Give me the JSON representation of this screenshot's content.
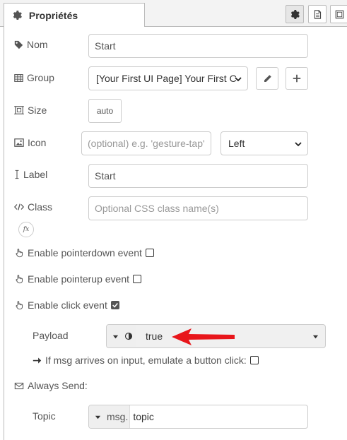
{
  "tab": {
    "title": "Propriétés"
  },
  "icons": {
    "properties": "gear-icon",
    "description": "document-icon",
    "appearance": "window-frame-icon"
  },
  "form": {
    "name": {
      "label": "Nom",
      "value": "Start"
    },
    "group": {
      "label": "Group",
      "value": "[Your First UI Page] Your First C"
    },
    "size": {
      "label": "Size",
      "value": "auto"
    },
    "icon": {
      "label": "Icon",
      "placeholder": "(optional) e.g. 'gesture-tap'",
      "position": "Left"
    },
    "label_field": {
      "label": "Label",
      "value": "Start"
    },
    "class": {
      "label": "Class",
      "placeholder": "Optional CSS class name(s)",
      "fx": "fx"
    },
    "pointerdown": {
      "label": "Enable pointerdown event",
      "checked": false
    },
    "pointerup": {
      "label": "Enable pointerup event",
      "checked": false
    },
    "click": {
      "label": "Enable click event",
      "checked": true
    },
    "payload": {
      "label": "Payload",
      "value": "true"
    },
    "emulate": {
      "label": "If msg arrives on input, emulate a button click:",
      "checked": false
    },
    "always_send": {
      "label": "Always Send:"
    },
    "topic": {
      "label": "Topic",
      "prefix": "msg.",
      "value": "topic"
    }
  },
  "colors": {
    "annotation_arrow": "#e8161b"
  }
}
